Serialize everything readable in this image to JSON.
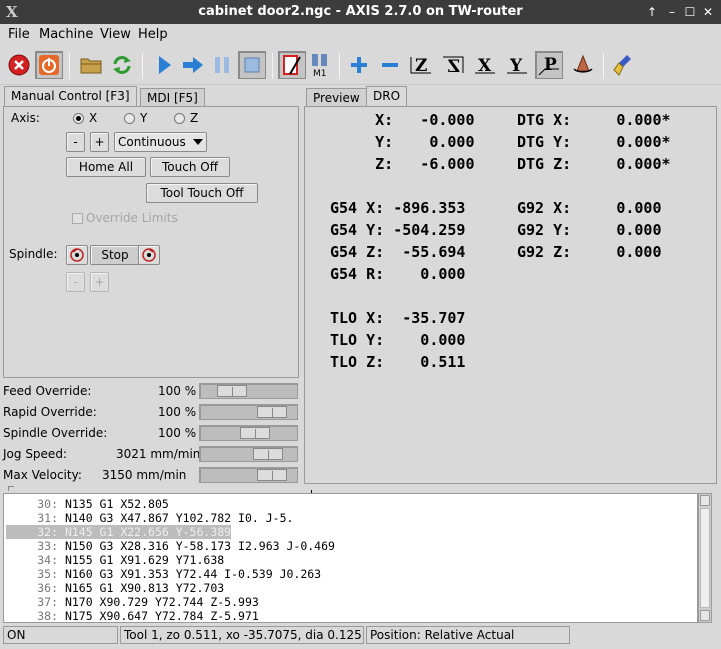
{
  "window": {
    "title": "cabinet door2.ngc - AXIS 2.7.0 on TW-router",
    "logo": "X",
    "controls": [
      "↑",
      "–",
      "☐",
      "✕"
    ]
  },
  "menu": [
    "File",
    "Machine",
    "View",
    "Help"
  ],
  "toolbar": {
    "icons": [
      "estop-icon",
      "power-icon",
      "open-folder-icon",
      "reload-icon",
      "run-icon",
      "step-icon",
      "pause-icon",
      "stop-icon",
      "touch-off-line-icon",
      "m1-icon",
      "zoom-in-icon",
      "zoom-out-icon",
      "view-z-icon",
      "view-z2-icon",
      "view-x-icon",
      "view-y-icon",
      "view-p-icon",
      "rotate-icon",
      "clear-plot-icon"
    ],
    "m1_label": "M1",
    "view_labels": {
      "z": "Z",
      "z2": "Z",
      "x": "X",
      "y": "Y",
      "p": "P"
    }
  },
  "left_tabs": [
    "Manual Control [F3]",
    "MDI [F5]"
  ],
  "manual": {
    "axis_label": "Axis:",
    "axes": [
      "X",
      "Y",
      "Z"
    ],
    "selected_axis": "X",
    "minus": "-",
    "plus": "+",
    "jog_mode": "Continuous",
    "home_all": "Home All",
    "touch_off": "Touch Off",
    "tool_touch_off": "Tool Touch Off",
    "override_limits": "Override Limits",
    "spindle_label": "Spindle:",
    "spindle_stop": "Stop",
    "spindle_minus": "-",
    "spindle_plus": "+"
  },
  "overrides": [
    {
      "label": "Feed Override:",
      "value": "100 %",
      "fraction": 0.24
    },
    {
      "label": "Rapid Override:",
      "value": "100 %",
      "fraction": 0.86
    },
    {
      "label": "Spindle Override:",
      "value": "100 %",
      "fraction": 0.6
    },
    {
      "label": "Jog Speed:",
      "value": "3021 mm/min",
      "fraction": 0.8
    },
    {
      "label": "Max Velocity:",
      "value": "3150 mm/min",
      "fraction": 0.86
    }
  ],
  "right_tabs": [
    "Preview",
    "DRO"
  ],
  "dro": {
    "col1": [
      "     X:   -0.000",
      "     Y:    0.000",
      "     Z:   -6.000",
      "",
      "G54 X: -896.353",
      "G54 Y: -504.259",
      "G54 Z:  -55.694",
      "G54 R:    0.000",
      "",
      "TLO X:  -35.707",
      "TLO Y:    0.000",
      "TLO Z:    0.511"
    ],
    "col2": [
      "DTG X:     0.000*",
      "DTG Y:     0.000*",
      "DTG Z:     0.000*",
      "",
      "G92 X:     0.000",
      "G92 Y:     0.000",
      "G92 Z:     0.000"
    ]
  },
  "gcode": [
    {
      "n": "30:",
      "text": "N135 G1 X52.805"
    },
    {
      "n": "31:",
      "text": "N140 G3 X47.867 Y102.782 I0. J-5."
    },
    {
      "n": "32:",
      "text": "N145 G1 X22.656 Y-56.389"
    },
    {
      "n": "33:",
      "text": "N150 G3 X28.316 Y-58.173 I2.963 J-0.469"
    },
    {
      "n": "34:",
      "text": "N155 G1 X91.629 Y71.638"
    },
    {
      "n": "35:",
      "text": "N160 G3 X91.353 Y72.44 I-0.539 J0.263"
    },
    {
      "n": "36:",
      "text": "N165 G1 X90.813 Y72.703"
    },
    {
      "n": "37:",
      "text": "N170 X90.729 Y72.744 Z-5.993"
    },
    {
      "n": "38:",
      "text": "N175 X90.647 Y72.784 Z-5.971"
    }
  ],
  "highlighted_line": "32:",
  "status": {
    "state": "ON",
    "tool": "Tool 1, zo 0.511, xo -35.7075, dia 0.125",
    "position": "Position: Relative Actual"
  },
  "colors": {
    "titlebar": "#3c3c3c",
    "highlight": "#bcbcbc",
    "estop": "#d32020",
    "power": "#e56a2a",
    "accent_blue": "#2a7fd4"
  }
}
